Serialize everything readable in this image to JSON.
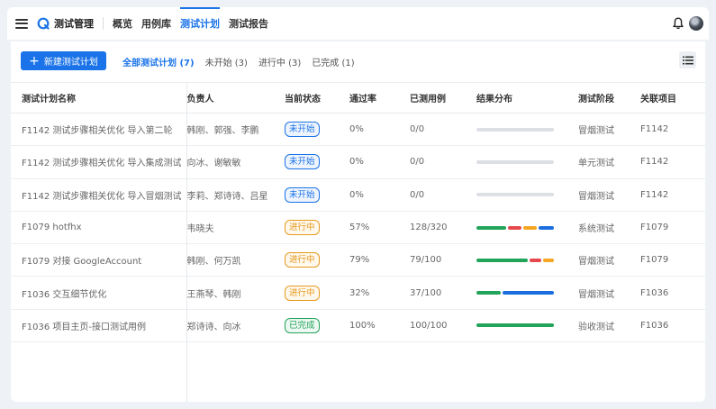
{
  "brand": "测试管理",
  "nav": [
    {
      "label": "概览",
      "active": false
    },
    {
      "label": "用例库",
      "active": false
    },
    {
      "label": "测试计划",
      "active": true
    },
    {
      "label": "测试报告",
      "active": false
    }
  ],
  "toolbar": {
    "new_label": "新建测试计划",
    "filters": [
      {
        "label": "全部测试计划 (7)",
        "active": true
      },
      {
        "label": "未开始 (3)",
        "active": false
      },
      {
        "label": "进行中 (3)",
        "active": false
      },
      {
        "label": "已完成 (1)",
        "active": false
      }
    ]
  },
  "table": {
    "headers": [
      "测试计划名称",
      "负责人",
      "当前状态",
      "通过率",
      "已测用例",
      "结果分布",
      "测试阶段",
      "关联项目"
    ],
    "rows": [
      {
        "name": "F1142 测试步骤相关优化 导入第二轮",
        "owner": "韩刚、郭强、李鹏",
        "status": "未开始",
        "status_key": "pending",
        "pass_rate": "0%",
        "tested": "0/0",
        "dist": [],
        "stage": "冒烟测试",
        "project": "F1142"
      },
      {
        "name": "F1142 测试步骤相关优化 导入集成测试",
        "owner": "向冰、谢敏敏",
        "status": "未开始",
        "status_key": "pending",
        "pass_rate": "0%",
        "tested": "0/0",
        "dist": [],
        "stage": "单元测试",
        "project": "F1142"
      },
      {
        "name": "F1142 测试步骤相关优化 导入冒烟测试",
        "owner": "李莉、郑诗诗、吕星",
        "status": "未开始",
        "status_key": "pending",
        "pass_rate": "0%",
        "tested": "0/0",
        "dist": [],
        "stage": "冒烟测试",
        "project": "F1142"
      },
      {
        "name": "F1079 hotfhx",
        "owner": "韦晓夫",
        "status": "进行中",
        "status_key": "progress",
        "pass_rate": "57%",
        "tested": "128/320",
        "dist": [
          {
            "kind": "pass",
            "value": 40
          },
          {
            "kind": "fail",
            "value": 18
          },
          {
            "kind": "blocked",
            "value": 18
          },
          {
            "kind": "other",
            "value": 20
          }
        ],
        "stage": "系统测试",
        "project": "F1079"
      },
      {
        "name": "F1079 对接 GoogleAccount",
        "owner": "韩刚、何万凯",
        "status": "进行中",
        "status_key": "progress",
        "pass_rate": "79%",
        "tested": "79/100",
        "dist": [
          {
            "kind": "pass",
            "value": 64
          },
          {
            "kind": "fail",
            "value": 14
          },
          {
            "kind": "blocked",
            "value": 14
          }
        ],
        "stage": "冒烟测试",
        "project": "F1079"
      },
      {
        "name": "F1036 交互细节优化",
        "owner": "王燕琴、韩刚",
        "status": "进行中",
        "status_key": "progress",
        "pass_rate": "32%",
        "tested": "37/100",
        "dist": [
          {
            "kind": "pass",
            "value": 32
          },
          {
            "kind": "other",
            "value": 68
          }
        ],
        "stage": "冒烟测试",
        "project": "F1036"
      },
      {
        "name": "F1036 项目主页-接口测试用例",
        "owner": "郑诗诗、向冰",
        "status": "已完成",
        "status_key": "done",
        "pass_rate": "100%",
        "tested": "100/100",
        "dist": [
          {
            "kind": "pass",
            "value": 100
          }
        ],
        "stage": "验收测试",
        "project": "F1036"
      }
    ]
  },
  "colors": {
    "accent": "#1a73e8",
    "pass": "#22a45a",
    "fail": "#e5484d",
    "blocked": "#f5a623",
    "other": "#1a6ee0",
    "empty": "#dcdfe4",
    "status": {
      "pending": {
        "fg": "#1a73e8",
        "bg": "#eef4fe"
      },
      "progress": {
        "fg": "#e69a1f",
        "bg": "#fff8ec"
      },
      "done": {
        "fg": "#22a45a",
        "bg": "#ecf8f1"
      }
    }
  },
  "icons": {
    "menu": "hamburger-icon",
    "logo": "logo-icon",
    "plus": "plus-icon",
    "bell": "bell-icon",
    "list": "list-view-icon"
  }
}
